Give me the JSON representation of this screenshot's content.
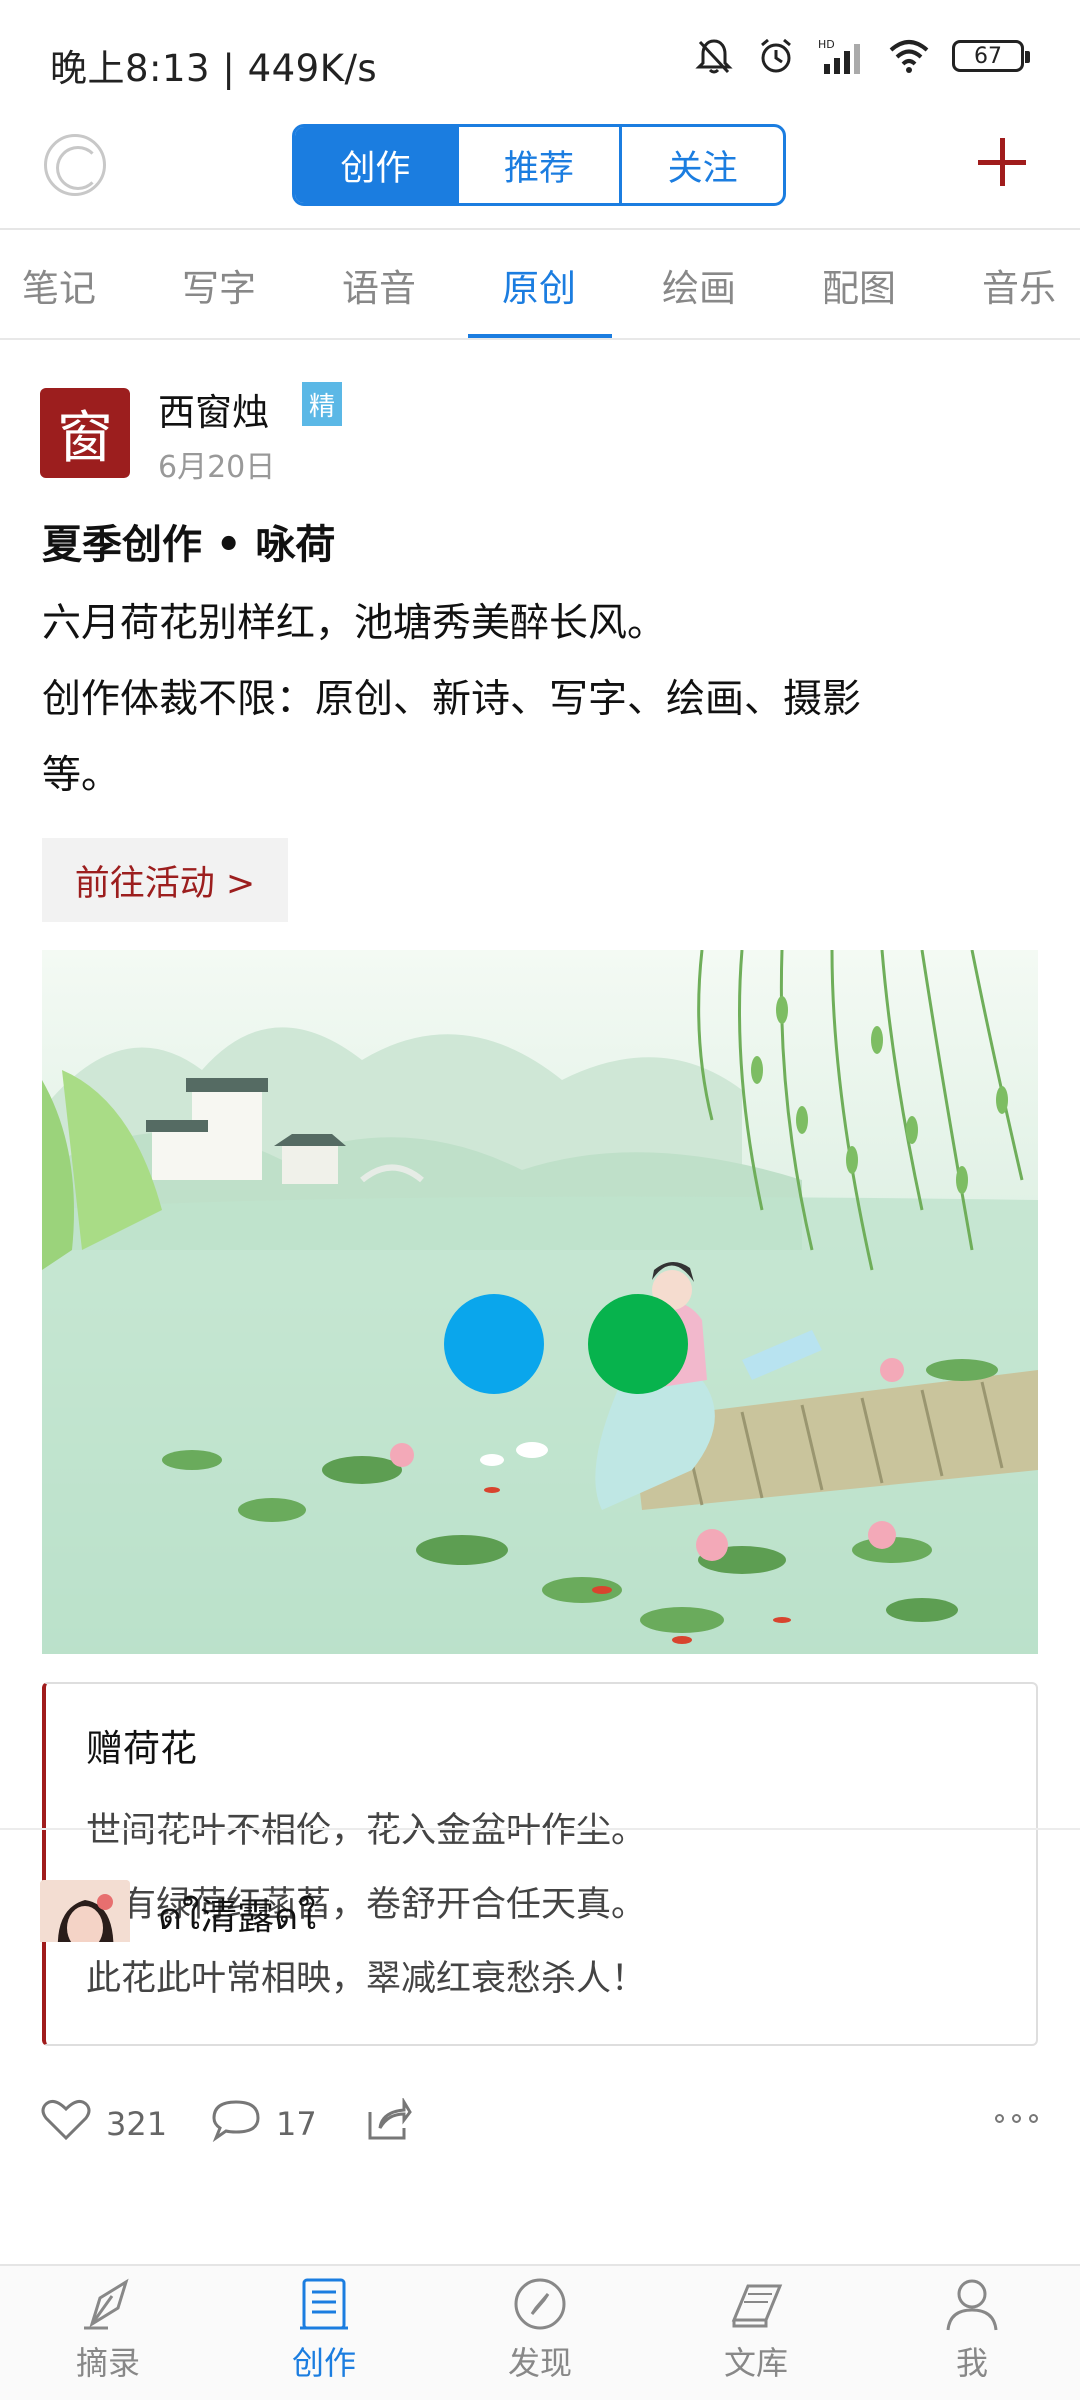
{
  "status_bar": {
    "time_speed": "晚上8:13 | 449K/s",
    "network": "HD",
    "battery": "67"
  },
  "header": {
    "segments": [
      "创作",
      "推荐",
      "关注"
    ],
    "active_segment": "创作"
  },
  "category_tabs": {
    "items": [
      "笔记",
      "写字",
      "语音",
      "原创",
      "绘画",
      "配图",
      "音乐"
    ],
    "active": "原创"
  },
  "post": {
    "author": "西窗烛",
    "avatar_glyph": "窗",
    "badge": "精",
    "date": "6月20日",
    "title": "夏季创作 • 咏荷",
    "body_lines": [
      "六月荷花别样红，池塘秀美醉长风。",
      "创作体裁不限：原创、新诗、写字、绘画、摄影",
      "等。"
    ],
    "event_button": "前往活动 >",
    "poem": {
      "title": "赠荷花",
      "lines": [
        "世间花叶不相伦，花入金盆叶作尘。",
        "惟有绿荷红菡萏，卷舒开合任天真。",
        "此花此叶常相映，翠减红衰愁杀人！"
      ]
    },
    "likes": "321",
    "comments": "17"
  },
  "next_post": {
    "author": "ดใ清露ดใ"
  },
  "bottom_nav": {
    "items": [
      "摘录",
      "创作",
      "发现",
      "文库",
      "我"
    ],
    "active": "创作"
  },
  "colors": {
    "accent_blue": "#1b7de0",
    "brand_red": "#9c1e1e",
    "badge_blue": "#5bb8e6",
    "share_blue": "#0aa6ec",
    "share_green": "#07b34d"
  }
}
